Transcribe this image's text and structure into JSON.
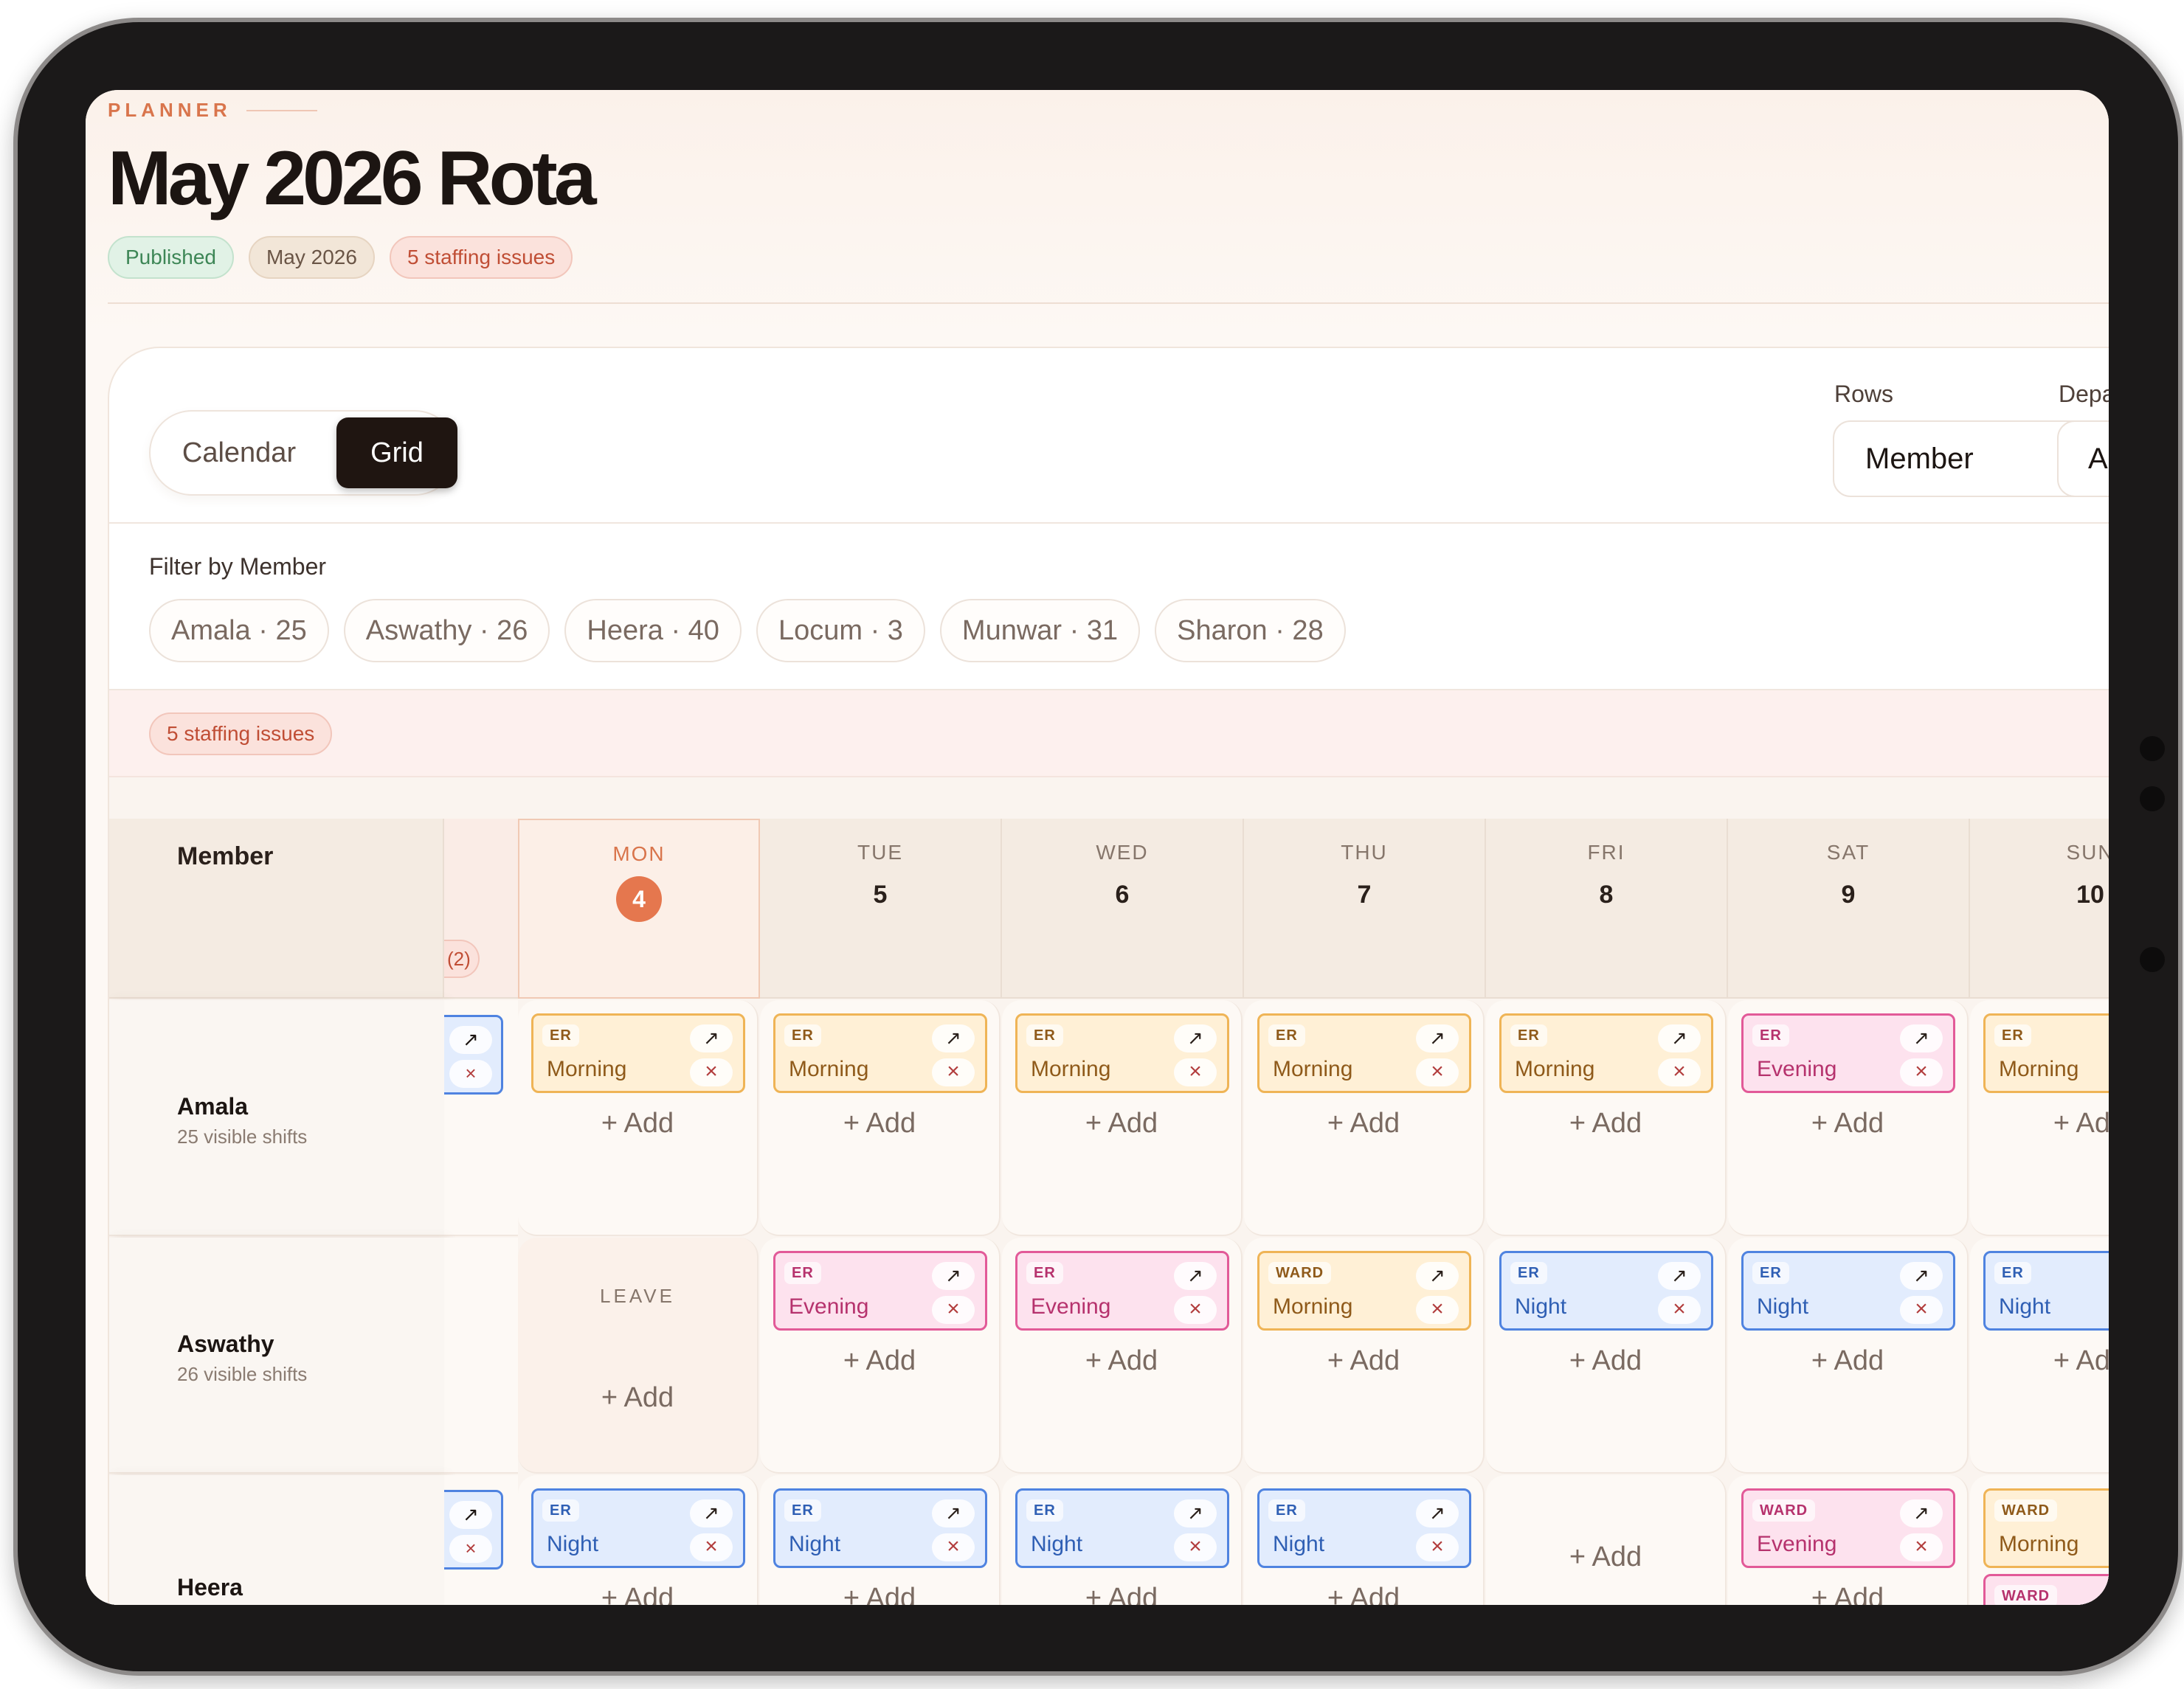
{
  "header": {
    "kicker": "PLANNER",
    "title": "May 2026 Rota",
    "badges": {
      "published": "Published",
      "month": "May 2026",
      "issues": "5 staffing issues"
    }
  },
  "toolbar": {
    "view_options": [
      "Calendar",
      "Grid"
    ],
    "active_view": "Grid",
    "rows_label": "Rows",
    "rows_value": "Member",
    "department_label": "Depa",
    "department_value": "Al"
  },
  "filters": {
    "label": "Filter by Member",
    "chips": [
      "Amala · 25",
      "Aswathy · 26",
      "Heera · 40",
      "Locum · 3",
      "Munwar · 31",
      "Sharon · 28"
    ]
  },
  "issues_bar": {
    "label": "5 staffing issues"
  },
  "grid": {
    "member_header": "Member",
    "prev_issue_badge": "(2)",
    "add_label": "+ Add",
    "leave_label": "LEAVE",
    "days": [
      {
        "dow": "MON",
        "num": "4",
        "today": true
      },
      {
        "dow": "TUE",
        "num": "5"
      },
      {
        "dow": "WED",
        "num": "6"
      },
      {
        "dow": "THU",
        "num": "7"
      },
      {
        "dow": "FRI",
        "num": "8"
      },
      {
        "dow": "SAT",
        "num": "9"
      },
      {
        "dow": "SUN",
        "num": "10"
      }
    ],
    "rows": [
      {
        "name": "Amala",
        "sub": "25 visible shifts",
        "cells": [
          {
            "shifts": [
              {
                "tag": "ER",
                "name": "Morning",
                "kind": "morning"
              }
            ]
          },
          {
            "shifts": [
              {
                "tag": "ER",
                "name": "Morning",
                "kind": "morning"
              }
            ]
          },
          {
            "shifts": [
              {
                "tag": "ER",
                "name": "Morning",
                "kind": "morning"
              }
            ]
          },
          {
            "shifts": [
              {
                "tag": "ER",
                "name": "Morning",
                "kind": "morning"
              }
            ]
          },
          {
            "shifts": [
              {
                "tag": "ER",
                "name": "Morning",
                "kind": "morning"
              }
            ]
          },
          {
            "shifts": [
              {
                "tag": "ER",
                "name": "Evening",
                "kind": "evening"
              }
            ]
          },
          {
            "shifts": [
              {
                "tag": "ER",
                "name": "Morning",
                "kind": "morning"
              }
            ]
          }
        ]
      },
      {
        "name": "Aswathy",
        "sub": "26 visible shifts",
        "cells": [
          {
            "leave": true,
            "shifts": []
          },
          {
            "shifts": [
              {
                "tag": "ER",
                "name": "Evening",
                "kind": "evening"
              }
            ]
          },
          {
            "shifts": [
              {
                "tag": "ER",
                "name": "Evening",
                "kind": "evening"
              }
            ]
          },
          {
            "shifts": [
              {
                "tag": "WARD",
                "name": "Morning",
                "kind": "morning"
              }
            ]
          },
          {
            "shifts": [
              {
                "tag": "ER",
                "name": "Night",
                "kind": "night"
              }
            ]
          },
          {
            "shifts": [
              {
                "tag": "ER",
                "name": "Night",
                "kind": "night"
              }
            ]
          },
          {
            "shifts": [
              {
                "tag": "ER",
                "name": "Night",
                "kind": "night"
              }
            ]
          }
        ]
      },
      {
        "name": "Heera",
        "sub": "",
        "cells": [
          {
            "shifts": [
              {
                "tag": "ER",
                "name": "Night",
                "kind": "night"
              }
            ]
          },
          {
            "shifts": [
              {
                "tag": "ER",
                "name": "Night",
                "kind": "night"
              }
            ]
          },
          {
            "shifts": [
              {
                "tag": "ER",
                "name": "Night",
                "kind": "night"
              }
            ]
          },
          {
            "shifts": [
              {
                "tag": "ER",
                "name": "Night",
                "kind": "night"
              }
            ]
          },
          {
            "shifts": []
          },
          {
            "shifts": [
              {
                "tag": "WARD",
                "name": "Evening",
                "kind": "evening"
              }
            ]
          },
          {
            "shifts": [
              {
                "tag": "WARD",
                "name": "Morning",
                "kind": "morning"
              },
              {
                "tag": "WARD",
                "name": "",
                "kind": "evening"
              }
            ]
          }
        ]
      }
    ]
  }
}
